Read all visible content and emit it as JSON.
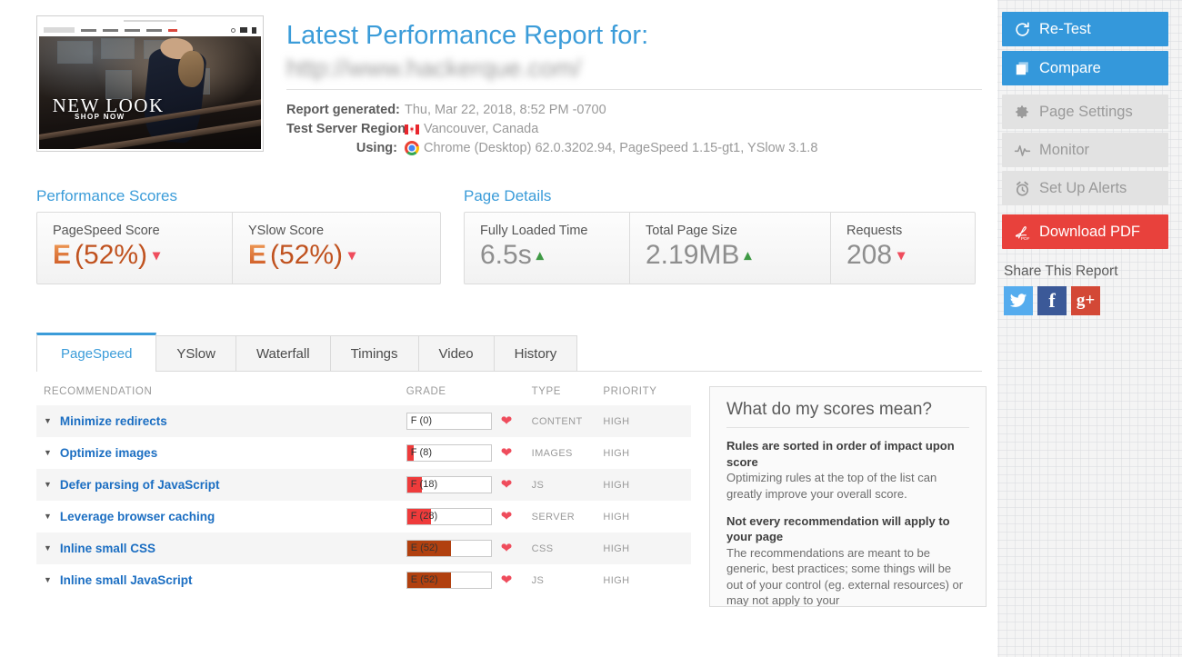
{
  "report": {
    "title": "Latest Performance Report for:",
    "url_blurred": "http://www.hackerque.com/",
    "meta": [
      {
        "label": "Report generated:",
        "value": "Thu, Mar 22, 2018, 8:52 PM -0700",
        "icon": ""
      },
      {
        "label": "Test Server Region:",
        "value": "Vancouver, Canada",
        "icon": "canada-flag-icon"
      },
      {
        "label": "Using:",
        "value": "Chrome (Desktop) 62.0.3202.94, PageSpeed 1.15-gt1, YSlow 3.1.8",
        "icon": "chrome-icon"
      }
    ],
    "thumbnail": {
      "headline": "NEW LOOK",
      "cta": "SHOP NOW"
    }
  },
  "performance_scores": {
    "group_title": "Performance Scores",
    "cards": [
      {
        "label": "PageSpeed Score",
        "grade": "E",
        "percent": "(52%)",
        "trend": "down"
      },
      {
        "label": "YSlow Score",
        "grade": "E",
        "percent": "(52%)",
        "trend": "down"
      }
    ]
  },
  "page_details": {
    "group_title": "Page Details",
    "cards": [
      {
        "label": "Fully Loaded Time",
        "value": "6.5s",
        "trend": "up"
      },
      {
        "label": "Total Page Size",
        "value": "2.19MB",
        "trend": "up"
      },
      {
        "label": "Requests",
        "value": "208",
        "trend": "down"
      }
    ]
  },
  "tabs": [
    {
      "label": "PageSpeed",
      "active": true
    },
    {
      "label": "YSlow",
      "active": false
    },
    {
      "label": "Waterfall",
      "active": false
    },
    {
      "label": "Timings",
      "active": false
    },
    {
      "label": "Video",
      "active": false
    },
    {
      "label": "History",
      "active": false
    }
  ],
  "recommendations": {
    "columns": [
      "RECOMMENDATION",
      "GRADE",
      "TYPE",
      "PRIORITY"
    ],
    "rows": [
      {
        "name": "Minimize redirects",
        "grade_label": "F (0)",
        "grade_letter": "F",
        "score": 0,
        "color": "#ef3b3b",
        "type": "CONTENT",
        "priority": "HIGH"
      },
      {
        "name": "Optimize images",
        "grade_label": "F (8)",
        "grade_letter": "F",
        "score": 8,
        "color": "#ef3b3b",
        "type": "IMAGES",
        "priority": "HIGH"
      },
      {
        "name": "Defer parsing of JavaScript",
        "grade_label": "F (18)",
        "grade_letter": "F",
        "score": 18,
        "color": "#ef3b3b",
        "type": "JS",
        "priority": "HIGH"
      },
      {
        "name": "Leverage browser caching",
        "grade_label": "F (28)",
        "grade_letter": "F",
        "score": 28,
        "color": "#ef3b3b",
        "type": "SERVER",
        "priority": "HIGH"
      },
      {
        "name": "Inline small CSS",
        "grade_label": "E (52)",
        "grade_letter": "E",
        "score": 52,
        "color": "#b1400f",
        "type": "CSS",
        "priority": "HIGH"
      },
      {
        "name": "Inline small JavaScript",
        "grade_label": "E (52)",
        "grade_letter": "E",
        "score": 52,
        "color": "#b1400f",
        "type": "JS",
        "priority": "HIGH"
      }
    ]
  },
  "scores_panel": {
    "title": "What do my scores mean?",
    "items": [
      {
        "heading": "Rules are sorted in order of impact upon score",
        "body": "Optimizing rules at the top of the list can greatly improve your overall score."
      },
      {
        "heading": "Not every recommendation will apply to your page",
        "body": "The recommendations are meant to be generic, best practices; some things will be out of your control (eg. external resources) or may not apply to your"
      }
    ]
  },
  "sidebar": {
    "buttons": [
      {
        "label": "Re-Test",
        "style": "blue",
        "icon": "refresh-icon"
      },
      {
        "label": "Compare",
        "style": "blue",
        "icon": "compare-icon"
      },
      {
        "label": "Page Settings",
        "style": "grey",
        "icon": "gear-icon"
      },
      {
        "label": "Monitor",
        "style": "grey",
        "icon": "pulse-icon"
      },
      {
        "label": "Set Up Alerts",
        "style": "grey",
        "icon": "alarm-clock-icon"
      },
      {
        "label": "Download PDF",
        "style": "red",
        "icon": "pdf-icon"
      }
    ],
    "share_title": "Share This Report",
    "socials": [
      {
        "name": "twitter-icon",
        "glyph": "🐦"
      },
      {
        "name": "facebook-icon",
        "glyph": "f"
      },
      {
        "name": "googleplus-icon",
        "glyph": "g+"
      }
    ]
  },
  "colors": {
    "accent_blue": "#3498db",
    "link_blue": "#3b9cd9",
    "danger_red": "#e8413c",
    "grade_f": "#ef3b3b",
    "grade_e": "#b1400f",
    "trend_up_green": "#3f9a45",
    "trend_down_red": "#ef4c5c"
  }
}
